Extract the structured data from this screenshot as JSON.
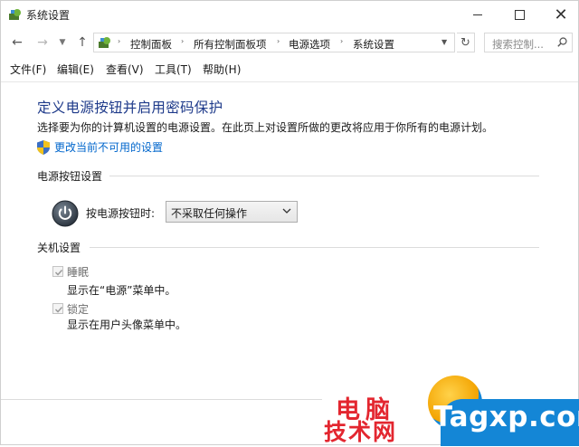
{
  "window": {
    "title": "系统设置",
    "controls": {
      "minimize": "minimize",
      "maximize": "maximize",
      "close": "✕"
    }
  },
  "navigation": {
    "breadcrumb": [
      "控制面板",
      "所有控制面板项",
      "电源选项",
      "系统设置"
    ],
    "search_placeholder": "搜索控制..."
  },
  "menubar": [
    "文件(F)",
    "编辑(E)",
    "查看(V)",
    "工具(T)",
    "帮助(H)"
  ],
  "content": {
    "heading": "定义电源按钮并启用密码保护",
    "description": "选择要为你的计算机设置的电源设置。在此页上对设置所做的更改将应用于你所有的电源计划。",
    "change_link": "更改当前不可用的设置",
    "power_group": {
      "label": "电源按钮设置",
      "power_button_label": "按电源按钮时:",
      "power_button_value": "不采取任何操作"
    },
    "shutdown_group": {
      "label": "关机设置",
      "options": [
        {
          "label": "睡眠",
          "description": "显示在“电源”菜单中。",
          "checked": true,
          "disabled": true
        },
        {
          "label": "锁定",
          "description": "显示在用户头像菜单中。",
          "checked": true,
          "disabled": true
        }
      ]
    }
  },
  "watermark": {
    "line1": "电脑",
    "line2": "技术网",
    "logo_text": "Tagxp.com"
  },
  "colors": {
    "heading": "#1e3a8a",
    "link": "#0066cc",
    "watermark_red": "#e3262f",
    "watermark_blue": "#1486d6"
  }
}
